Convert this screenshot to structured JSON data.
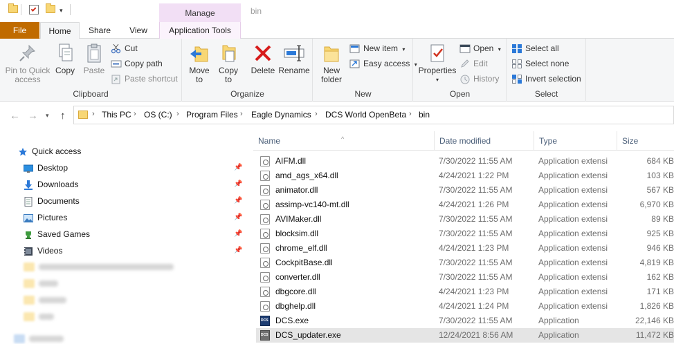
{
  "window": {
    "title": "bin",
    "context_tab_group": "Manage"
  },
  "tabs": [
    {
      "label": "File"
    },
    {
      "label": "Home"
    },
    {
      "label": "Share"
    },
    {
      "label": "View"
    },
    {
      "label": "Application Tools"
    }
  ],
  "ribbon": {
    "clipboard": {
      "label": "Clipboard",
      "pin_quick_access": "Pin to Quick access",
      "copy": "Copy",
      "paste": "Paste",
      "cut": "Cut",
      "copy_path": "Copy path",
      "paste_shortcut": "Paste shortcut"
    },
    "organize": {
      "label": "Organize",
      "move_to": "Move to",
      "copy_to": "Copy to",
      "delete": "Delete",
      "rename": "Rename"
    },
    "new": {
      "label": "New",
      "new_folder": "New folder",
      "new_item": "New item",
      "easy_access": "Easy access"
    },
    "open": {
      "label": "Open",
      "properties": "Properties",
      "open": "Open",
      "edit": "Edit",
      "history": "History"
    },
    "select": {
      "label": "Select",
      "select_all": "Select all",
      "select_none": "Select none",
      "invert_selection": "Invert selection"
    }
  },
  "address": {
    "crumbs": [
      "This PC",
      "OS (C:)",
      "Program Files",
      "Eagle Dynamics",
      "DCS World OpenBeta",
      "bin"
    ]
  },
  "navpane": {
    "quick_access": "Quick access",
    "items": [
      {
        "label": "Desktop",
        "icon": "desktop-icon"
      },
      {
        "label": "Downloads",
        "icon": "downloads-icon"
      },
      {
        "label": "Documents",
        "icon": "documents-icon"
      },
      {
        "label": "Pictures",
        "icon": "pictures-icon"
      },
      {
        "label": "Saved Games",
        "icon": "saved-games-icon"
      },
      {
        "label": "Videos",
        "icon": "videos-icon"
      }
    ]
  },
  "columns": {
    "name": "Name",
    "date": "Date modified",
    "type": "Type",
    "size": "Size"
  },
  "files": [
    {
      "name": "AIFM.dll",
      "date": "7/30/2022 11:55 AM",
      "type": "Application extension",
      "size": "684 KB",
      "kind": "dll"
    },
    {
      "name": "amd_ags_x64.dll",
      "date": "4/24/2021 1:22 PM",
      "type": "Application extension",
      "size": "103 KB",
      "kind": "dll"
    },
    {
      "name": "animator.dll",
      "date": "7/30/2022 11:55 AM",
      "type": "Application extension",
      "size": "567 KB",
      "kind": "dll"
    },
    {
      "name": "assimp-vc140-mt.dll",
      "date": "4/24/2021 1:26 PM",
      "type": "Application extension",
      "size": "6,970 KB",
      "kind": "dll"
    },
    {
      "name": "AVIMaker.dll",
      "date": "7/30/2022 11:55 AM",
      "type": "Application extension",
      "size": "89 KB",
      "kind": "dll"
    },
    {
      "name": "blocksim.dll",
      "date": "7/30/2022 11:55 AM",
      "type": "Application extension",
      "size": "925 KB",
      "kind": "dll"
    },
    {
      "name": "chrome_elf.dll",
      "date": "4/24/2021 1:23 PM",
      "type": "Application extension",
      "size": "946 KB",
      "kind": "dll"
    },
    {
      "name": "CockpitBase.dll",
      "date": "7/30/2022 11:55 AM",
      "type": "Application extension",
      "size": "4,819 KB",
      "kind": "dll"
    },
    {
      "name": "converter.dll",
      "date": "7/30/2022 11:55 AM",
      "type": "Application extension",
      "size": "162 KB",
      "kind": "dll"
    },
    {
      "name": "dbgcore.dll",
      "date": "4/24/2021 1:23 PM",
      "type": "Application extension",
      "size": "171 KB",
      "kind": "dll"
    },
    {
      "name": "dbghelp.dll",
      "date": "4/24/2021 1:24 PM",
      "type": "Application extension",
      "size": "1,826 KB",
      "kind": "dll"
    },
    {
      "name": "DCS.exe",
      "date": "7/30/2022 11:55 AM",
      "type": "Application",
      "size": "22,146 KB",
      "kind": "exe"
    },
    {
      "name": "DCS_updater.exe",
      "date": "12/24/2021 8:56 AM",
      "type": "Application",
      "size": "11,472 KB",
      "kind": "exe",
      "selected": true
    }
  ],
  "colors": {
    "file_tab": "#c06b00",
    "context_tab": "#f2dff5",
    "selected_row": "#e5e5e5",
    "header_text": "#4c607a"
  }
}
